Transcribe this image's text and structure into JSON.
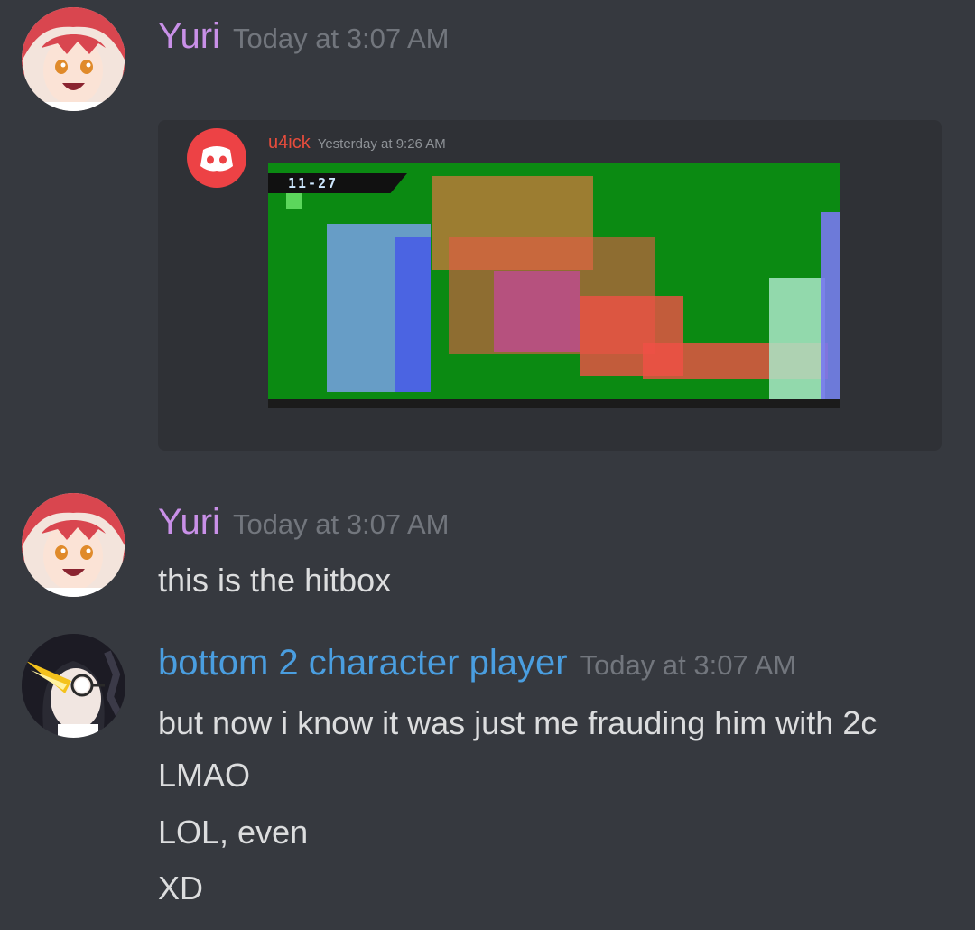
{
  "messages": [
    {
      "username": "Yuri",
      "username_color": "#c990e8",
      "timestamp": "Today at 3:07 AM",
      "avatar_icon": "anime-girl-avatar",
      "embed": {
        "icon": "discord-logo-icon",
        "username": "u4ick",
        "timestamp": "Yesterday at 9:26 AM",
        "game_frame_counter": "11-27"
      }
    },
    {
      "username": "Yuri",
      "username_color": "#c990e8",
      "timestamp": "Today at 3:07 AM",
      "avatar_icon": "anime-girl-avatar",
      "lines": [
        "this is the hitbox"
      ]
    },
    {
      "username": "bottom 2 character player",
      "username_color": "#4a9ee0",
      "timestamp": "Today at 3:07 AM",
      "avatar_icon": "glasses-character-avatar",
      "lines": [
        "but now i know it was just me frauding him with 2c",
        "LMAO",
        "LOL, even",
        "XD"
      ]
    }
  ],
  "colors": {
    "background": "#36393f",
    "timestamp": "#72767d",
    "text": "#dcddde"
  }
}
